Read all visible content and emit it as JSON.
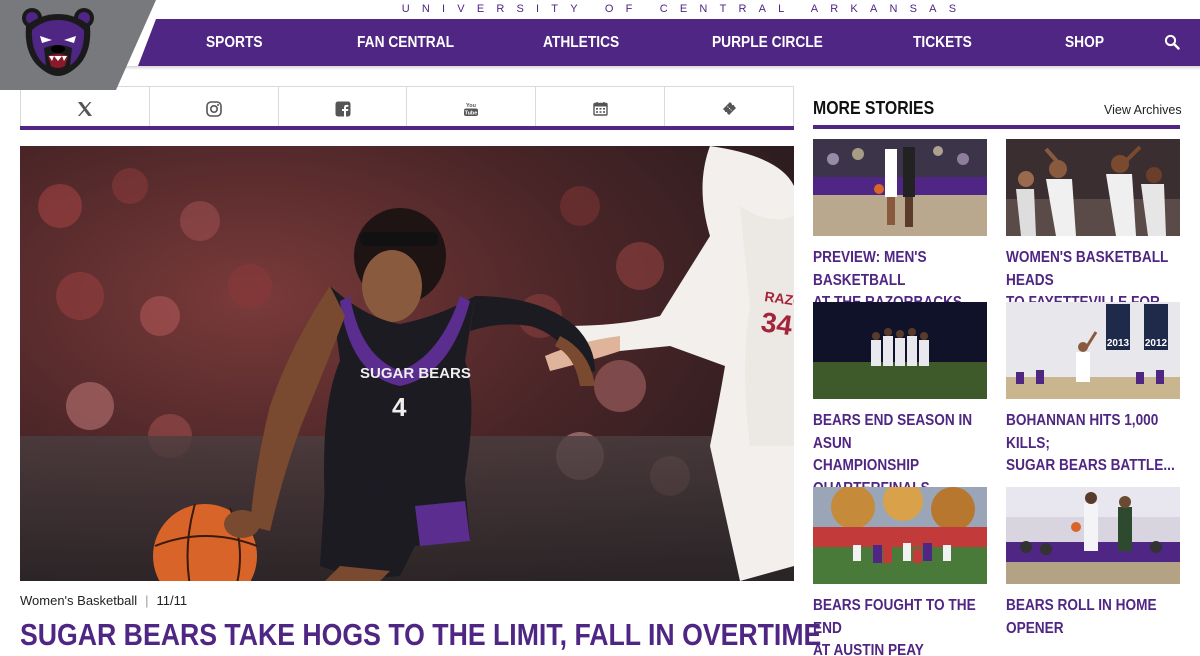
{
  "header": {
    "university_name": "UNIVERSITY OF CENTRAL ARKANSAS",
    "nav": [
      "SPORTS",
      "FAN CENTRAL",
      "ATHLETICS",
      "PURPLE CIRCLE",
      "TICKETS",
      "SHOP"
    ],
    "search_icon": "search-icon",
    "logo_icon": "bear-head-logo"
  },
  "social": {
    "icons": [
      "x-twitter-icon",
      "instagram-icon",
      "facebook-icon",
      "youtube-icon",
      "calendar-icon",
      "ticket-icon"
    ]
  },
  "hero": {
    "sport": "Women's Basketball",
    "separator": "|",
    "date": "11/11",
    "title": "SUGAR BEARS TAKE HOGS TO THE LIMIT, FALL IN OVERTIME",
    "jersey_text": "SUGAR BEARS",
    "jersey_number": "4",
    "opponent_jersey": "RAZORBACKS",
    "opponent_number": "34"
  },
  "more_stories": {
    "title": "MORE STORIES",
    "archive_label": "View Archives",
    "stories": [
      {
        "title_lines": [
          "PREVIEW: MEN'S BASKETBALL",
          "AT THE RAZORBACKS"
        ]
      },
      {
        "title_lines": [
          "WOMEN'S BASKETBALL HEADS",
          "TO FAYETTEVILLE FOR..."
        ]
      },
      {
        "title_lines": [
          "BEARS END SEASON IN ASUN",
          "CHAMPIONSHIP",
          "QUARTERFINALS"
        ]
      },
      {
        "title_lines": [
          "BOHANNAN HITS 1,000 KILLS;",
          "SUGAR BEARS BATTLE..."
        ]
      },
      {
        "title_lines": [
          "BEARS FOUGHT TO THE END",
          "AT AUSTIN PEAY"
        ]
      },
      {
        "title_lines": [
          "BEARS ROLL IN HOME",
          "OPENER"
        ]
      }
    ],
    "banner_years": [
      "2013",
      "2012"
    ]
  },
  "colors": {
    "brand_purple": "#4f2683",
    "logo_gray": "#77797c"
  }
}
